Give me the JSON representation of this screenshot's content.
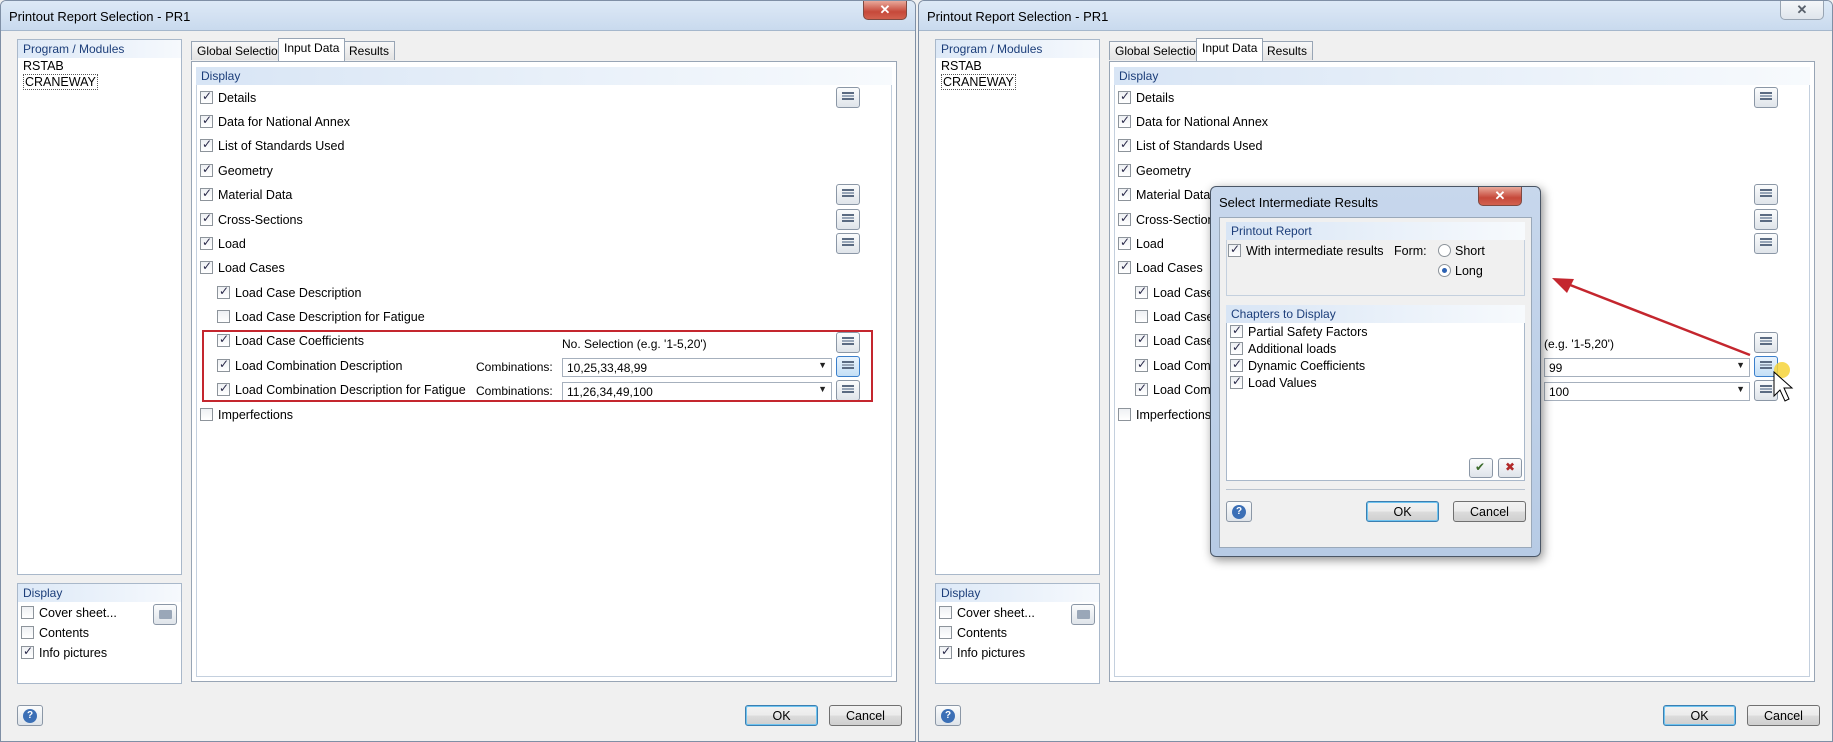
{
  "left_window": {
    "title": "Printout Report Selection - PR1",
    "close_label": "✕",
    "modules_header": "Program / Modules",
    "modules": [
      {
        "label": "RSTAB"
      },
      {
        "label": "CRANEWAY"
      }
    ],
    "display_header": "Display",
    "display_items": [
      {
        "label": "Cover sheet...",
        "checked": false
      },
      {
        "label": "Contents",
        "checked": false
      },
      {
        "label": "Info pictures",
        "checked": true
      }
    ],
    "tabs": [
      "Global Selection",
      "Input Data",
      "Results"
    ],
    "section_header": "Display",
    "items": [
      {
        "label": "Details",
        "checked": true
      },
      {
        "label": "Data for National Annex",
        "checked": true
      },
      {
        "label": "List of Standards Used",
        "checked": true
      },
      {
        "label": "Geometry",
        "checked": true
      },
      {
        "label": "Material Data",
        "checked": true
      },
      {
        "label": "Cross-Sections",
        "checked": true
      },
      {
        "label": "Load",
        "checked": true
      },
      {
        "label": "Load Cases",
        "checked": true
      },
      {
        "label": "Load Case Description",
        "checked": true
      },
      {
        "label": "Load Case Description for Fatigue",
        "checked": false
      },
      {
        "label": "Load Case Coefficients",
        "checked": true
      },
      {
        "label": "Load Combination Description",
        "checked": true
      },
      {
        "label": "Load Combination Description for Fatigue",
        "checked": true
      },
      {
        "label": "Imperfections",
        "checked": false
      }
    ],
    "no_selection_hint": "No. Selection (e.g. '1-5,20')",
    "combinations_label": "Combinations:",
    "combo1_value": "10,25,33,48,99",
    "combo2_value": "11,26,34,49,100",
    "ok_label": "OK",
    "cancel_label": "Cancel"
  },
  "right_window": {
    "title": "Printout Report Selection - PR1",
    "close_label": "✕",
    "modules_header": "Program / Modules",
    "modules": [
      {
        "label": "RSTAB"
      },
      {
        "label": "CRANEWAY"
      }
    ],
    "display_header": "Display",
    "display_items": [
      {
        "label": "Cover sheet...",
        "checked": false
      },
      {
        "label": "Contents",
        "checked": false
      },
      {
        "label": "Info pictures",
        "checked": true
      }
    ],
    "tabs": [
      "Global Selection",
      "Input Data",
      "Results"
    ],
    "section_header": "Display",
    "items": [
      {
        "label": "Details",
        "checked": true
      },
      {
        "label": "Data for National Annex",
        "checked": true
      },
      {
        "label": "List of Standards Used",
        "checked": true
      },
      {
        "label": "Geometry",
        "checked": true
      },
      {
        "label": "Material Data",
        "checked": true
      },
      {
        "label": "Cross-Sections",
        "checked": true
      },
      {
        "label": "Load",
        "checked": true
      },
      {
        "label": "Load Cases",
        "checked": true
      },
      {
        "label": "Load Case D",
        "checked": true
      },
      {
        "label": "Load Case D",
        "checked": false
      },
      {
        "label": "Load Case C",
        "checked": true
      },
      {
        "label": "Load Combin",
        "checked": true
      },
      {
        "label": "Load Combin",
        "checked": true
      },
      {
        "label": "Imperfections",
        "checked": false
      }
    ],
    "no_selection_hint": "(e.g. '1-5,20')",
    "combo1_value": "99",
    "combo2_value": "100",
    "ok_label": "OK",
    "cancel_label": "Cancel"
  },
  "dialog": {
    "title": "Select Intermediate Results",
    "close_label": "✕",
    "printout_header": "Printout Report",
    "with_intermediate_label": "With intermediate results",
    "with_intermediate_checked": true,
    "form_label": "Form:",
    "form_options": [
      {
        "label": "Short",
        "selected": false
      },
      {
        "label": "Long",
        "selected": true
      }
    ],
    "chapters_header": "Chapters to Display",
    "chapters": [
      {
        "label": "Partial Safety Factors",
        "checked": true
      },
      {
        "label": "Additional loads",
        "checked": true
      },
      {
        "label": "Dynamic Coefficients",
        "checked": true
      },
      {
        "label": "Load Values",
        "checked": true
      }
    ],
    "ok_label": "OK",
    "cancel_label": "Cancel"
  },
  "colors": {
    "highlight": "#c4262e",
    "arrow": "#c4262e",
    "header_text": "#1c3e7a"
  }
}
